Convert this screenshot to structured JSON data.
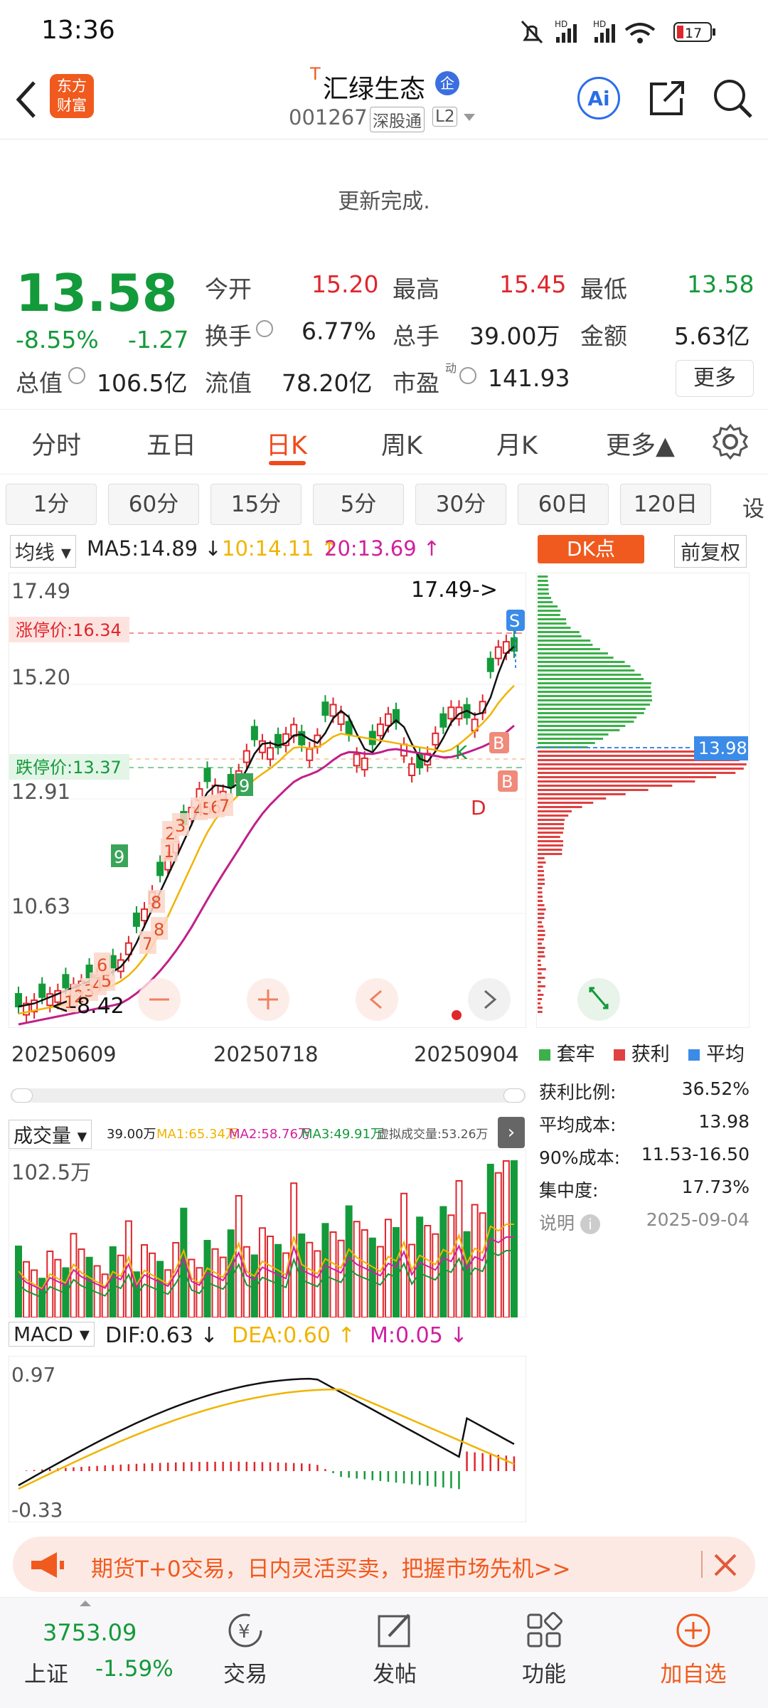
{
  "status": {
    "time": "13:36",
    "battery": "17"
  },
  "nav": {
    "logo_line1": "东方",
    "logo_line2": "财富",
    "t_mark": "T",
    "title": "汇绿生态",
    "badge": "企",
    "code": "001267",
    "tag1": "深股通",
    "tag2": "L2",
    "ai": "Ai"
  },
  "update_msg": "更新完成.",
  "quote": {
    "price": "13.58",
    "change_pct": "-8.55%",
    "change": "-1.27",
    "open_label": "今开",
    "open": "15.20",
    "high_label": "最高",
    "high": "15.45",
    "low_label": "最低",
    "low": "13.58",
    "turnover_label": "换手",
    "turnover": "6.77%",
    "volume_label": "总手",
    "volume": "39.00万",
    "amount_label": "金额",
    "amount": "5.63亿",
    "mcap_label": "总值",
    "mcap": "106.5亿",
    "float_label": "流值",
    "float": "78.20亿",
    "pe_label": "市盈",
    "pe_sup": "动",
    "pe": "141.93",
    "more": "更多"
  },
  "tabs": [
    "分时",
    "五日",
    "日K",
    "周K",
    "月K",
    "更多▲"
  ],
  "active_tab": "日K",
  "periods": [
    "1分",
    "60分",
    "15分",
    "5分",
    "30分",
    "60日",
    "120日",
    "设"
  ],
  "ma": {
    "label": "均线",
    "ma5": "MA5:14.89 ↓",
    "ma10": "10:14.11 ↑",
    "ma20": "20:13.69 ↑",
    "dk": "DK点",
    "adjust": "前复权"
  },
  "kchart": {
    "y_top": "17.49",
    "y2": "15.20",
    "y3": "12.91",
    "y4": "10.63",
    "max_note": "17.49->",
    "min_note": "<-8.42",
    "limit_up": "涨停价:16.34",
    "limit_down": "跌停价:13.37",
    "dates": [
      "20250609",
      "20250718",
      "20250904"
    ],
    "markers": {
      "s": "S",
      "b1": "B",
      "b2": "B",
      "d": "D",
      "k": "K"
    },
    "seq_labels": [
      "1",
      "2",
      "3",
      "4",
      "5",
      "6",
      "7",
      "8",
      "9",
      "1",
      "2",
      "3",
      "4",
      "5",
      "6",
      "7",
      "8",
      "9"
    ],
    "cost_price": "13.98"
  },
  "chip_dist": {
    "legend": [
      "套牢",
      "获利",
      "平均"
    ],
    "rows": [
      {
        "label": "获利比例:",
        "value": "36.52%"
      },
      {
        "label": "平均成本:",
        "value": "13.98"
      },
      {
        "label": "90%成本:",
        "value": "11.53-16.50"
      },
      {
        "label": "集中度:",
        "value": "17.73%"
      }
    ],
    "note": "说明",
    "date": "2025-09-04"
  },
  "volume": {
    "label": "成交量",
    "v": "39.00万",
    "ma1": "MA1:65.34万",
    "ma2": "MA2:58.76万",
    "ma3": "MA3:49.91万",
    "virtual": "虚拟成交量:53.26万",
    "y_top": "102.5万"
  },
  "macd": {
    "label": "MACD",
    "dif": "DIF:0.63 ↓",
    "dea": "DEA:0.60 ↑",
    "m": "M:0.05 ↓",
    "y_top": "0.97",
    "y_bottom": "-0.33"
  },
  "banner": {
    "text": "期货T+0交易，日内灵活买卖，把握市场先机>>"
  },
  "bottom": {
    "index_value": "3753.09",
    "index_name": "上证",
    "index_change": "-1.59%",
    "items": [
      "交易",
      "发帖",
      "功能",
      "加自选"
    ]
  },
  "colors": {
    "up": "#e0262c",
    "down": "#139a3a",
    "accent": "#f04a1a",
    "ma10": "#f0b400",
    "ma20": "#d020a0"
  }
}
